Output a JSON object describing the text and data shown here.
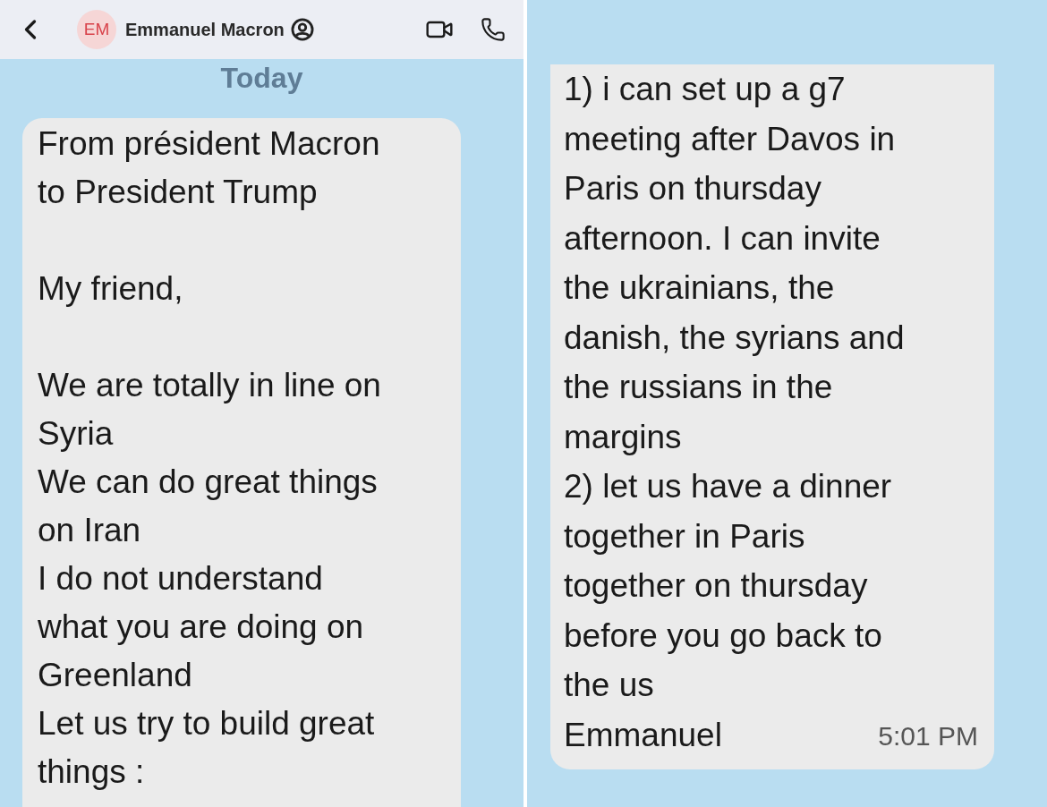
{
  "left_screen": {
    "header": {
      "avatar_initials": "EM",
      "contact_name": "Emmanuel Macron"
    },
    "date_label": "Today",
    "message": {
      "paragraphs": [
        [
          "From président Macron",
          "to President Trump"
        ],
        [
          "My friend,"
        ],
        [
          "We are totally in line on",
          "Syria",
          "We can do great things",
          "on Iran",
          "I do not understand",
          "what you are doing on",
          "Greenland",
          "Let us try to build great",
          "things :"
        ]
      ]
    }
  },
  "right_screen": {
    "message": {
      "paragraphs": [
        [
          "1) i can set up a g7",
          "meeting after Davos in",
          "Paris on thursday",
          "afternoon. I can invite",
          "the ukrainians, the",
          "danish, the syrians and",
          "the russians in the",
          "margins",
          "2) let us have a dinner",
          "together in Paris",
          "together on thursday",
          "before you go back to",
          "the us",
          "Emmanuel"
        ]
      ],
      "time": "5:01 PM"
    }
  }
}
